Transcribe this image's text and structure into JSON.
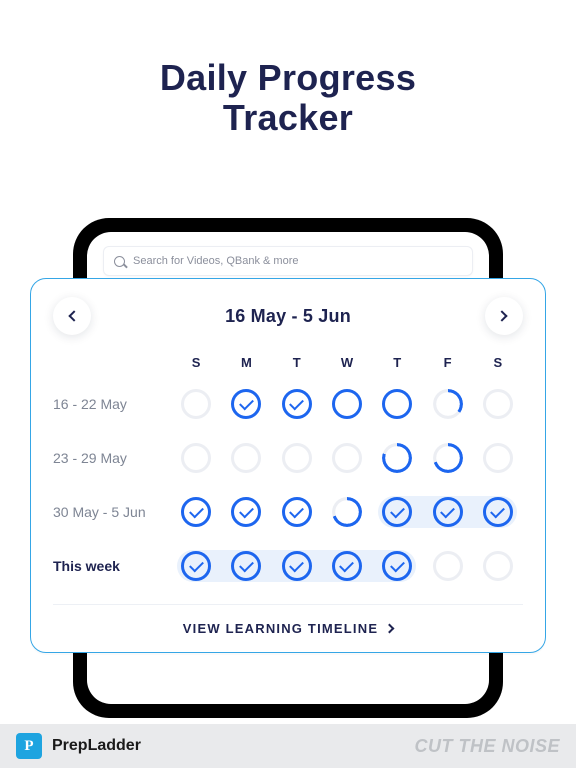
{
  "title_line1": "Daily Progress",
  "title_line2": "Tracker",
  "search": {
    "placeholder": "Search for Videos, QBank & more"
  },
  "range": "16 May  -  5 Jun",
  "day_headers": [
    "S",
    "M",
    "T",
    "W",
    "T",
    "F",
    "S"
  ],
  "rows": [
    {
      "label": "16 - 22 May",
      "strong": false,
      "cells": [
        {
          "type": "empty"
        },
        {
          "type": "check"
        },
        {
          "type": "check"
        },
        {
          "type": "full"
        },
        {
          "type": "full"
        },
        {
          "type": "arc",
          "pct": 35
        },
        {
          "type": "empty"
        }
      ],
      "band": null
    },
    {
      "label": "23 - 29 May",
      "strong": false,
      "cells": [
        {
          "type": "empty"
        },
        {
          "type": "empty"
        },
        {
          "type": "empty"
        },
        {
          "type": "empty"
        },
        {
          "type": "arc",
          "pct": 80
        },
        {
          "type": "arc",
          "pct": 70
        },
        {
          "type": "empty"
        }
      ],
      "band": null
    },
    {
      "label": "30 May - 5 Jun",
      "strong": false,
      "cells": [
        {
          "type": "check"
        },
        {
          "type": "check"
        },
        {
          "type": "check"
        },
        {
          "type": "arc",
          "pct": 70
        },
        {
          "type": "check"
        },
        {
          "type": "check"
        },
        {
          "type": "check"
        }
      ],
      "band": {
        "start": 4,
        "end": 6
      }
    },
    {
      "label": "This week",
      "strong": true,
      "cells": [
        {
          "type": "check"
        },
        {
          "type": "check"
        },
        {
          "type": "check"
        },
        {
          "type": "check"
        },
        {
          "type": "check"
        },
        {
          "type": "empty"
        },
        {
          "type": "empty"
        }
      ],
      "band": {
        "start": 0,
        "end": 4
      }
    }
  ],
  "timeline_link": "VIEW LEARNING TIMELINE",
  "footer": {
    "logo_letter": "P",
    "brand": "PrepLadder",
    "tagline": "CUT THE NOISE"
  },
  "colors": {
    "accent": "#1d66ef",
    "ring_empty": "#eceef3"
  }
}
